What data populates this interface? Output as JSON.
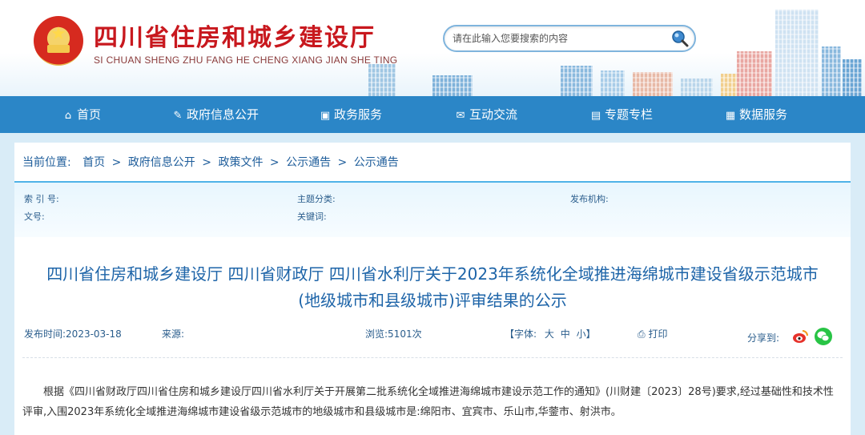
{
  "header": {
    "title": "四川省住房和城乡建设厅",
    "subtitle": "SI CHUAN SHENG ZHU FANG HE CHENG XIANG JIAN SHE TING",
    "search_placeholder": "请在此输入您要搜索的内容",
    "search_icon": "magnifier-icon"
  },
  "nav": {
    "items": [
      {
        "label": "首页",
        "icon": "home-icon"
      },
      {
        "label": "政府信息公开",
        "icon": "edit-icon"
      },
      {
        "label": "政务服务",
        "icon": "monitor-icon"
      },
      {
        "label": "互动交流",
        "icon": "chat-icon"
      },
      {
        "label": "专题专栏",
        "icon": "image-icon"
      },
      {
        "label": "数据服务",
        "icon": "grid-icon"
      }
    ]
  },
  "breadcrumb": {
    "prefix": "当前位置:",
    "items": [
      "首页",
      "政府信息公开",
      "政策文件",
      "公示通告",
      "公示通告"
    ],
    "separator": ">"
  },
  "meta": {
    "index_label": "索 引 号:",
    "category_label": "主题分类:",
    "publisher_label": "发布机构:",
    "doc_no_label": "文号:",
    "keywords_label": "关键词:"
  },
  "article": {
    "title_line1": "四川省住房和城乡建设厅 四川省财政厅 四川省水利厅关于2023年系统化全域推进海绵城市建设省级示范城市",
    "title_line2": "(地级城市和县级城市)评审结果的公示",
    "publish_time": "发布时间:2023-03-18",
    "source": "来源:",
    "views": "浏览:5101次",
    "font_label": "【字体:",
    "font_big": "大",
    "font_mid": "中",
    "font_small": "小】",
    "print": "打印",
    "share": "分享到:",
    "body": "根据《四川省财政厅四川省住房和城乡建设厅四川省水利厅关于开展第二批系统化全域推进海绵城市建设示范工作的通知》(川财建〔2023〕28号)要求,经过基础性和技术性评审,入围2023年系统化全域推进海绵城市建设省级示范城市的地级城市和县级城市是:绵阳市、宜宾市、乐山市,华蓥市、射洪市。"
  },
  "colors": {
    "brand_red": "#c8181e",
    "nav_blue": "#2b86c7",
    "title_blue": "#1d64a8"
  }
}
